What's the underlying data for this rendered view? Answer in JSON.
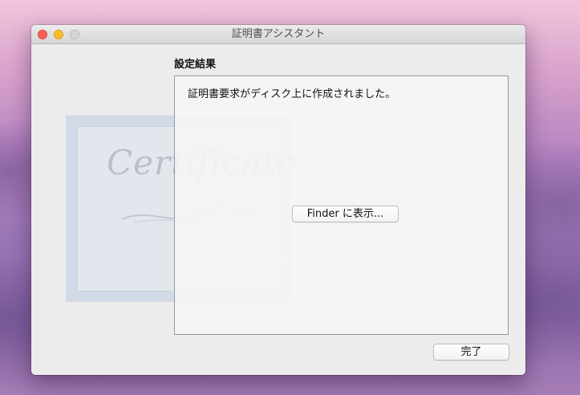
{
  "window": {
    "title": "証明書アシスタント"
  },
  "certificate_art": {
    "word": "Certificate"
  },
  "main": {
    "section_title": "設定結果",
    "message": "証明書要求がディスク上に作成されました。",
    "finder_button": "Finder に表示..."
  },
  "footer": {
    "done_button": "完了"
  },
  "icons": {
    "close": "close-icon",
    "minimize": "minimize-icon",
    "zoom": "zoom-icon"
  },
  "colors": {
    "close": "#fc5f57",
    "minimize": "#fdbc2e",
    "zoom_disabled": "#d5d5d5"
  }
}
